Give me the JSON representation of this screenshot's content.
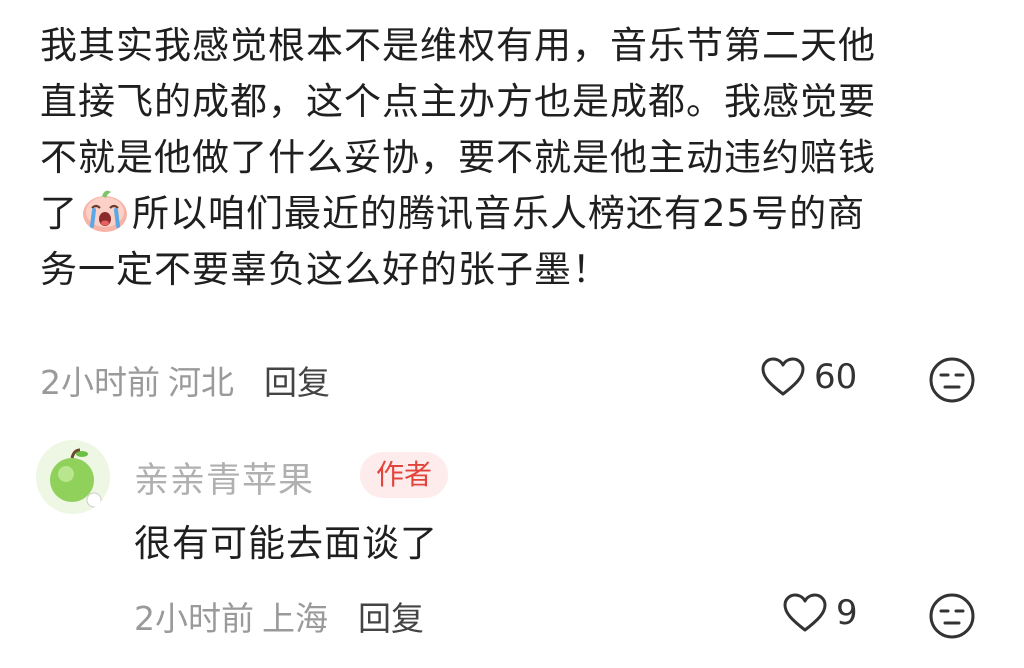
{
  "comment": {
    "lines": [
      "我其实我感觉根本不是维权有用，音乐节第二天他",
      "直接飞的成都，这个点主办方也是成都。我感觉要",
      "不就是他做了什么妥协，要不就是他主动违约赔钱"
    ],
    "line4_before_emoji": "了",
    "line4_after_emoji": "所以咱们最近的腾讯音乐人榜还有25号的商",
    "line5": "务一定不要辜负这么好的张子墨！",
    "emoji_name": "crying-emoji",
    "time": "2小时前",
    "location": "河北",
    "reply_label": "回复",
    "likes": "60"
  },
  "reply": {
    "username": "亲亲青苹果",
    "badge": "作者",
    "text": "很有可能去面谈了",
    "time": "2小时前",
    "location": "上海",
    "reply_label": "回复",
    "likes": "9"
  },
  "colors": {
    "meta_gray": "#9a9a9a",
    "badge_bg": "#fdeceb",
    "badge_text": "#e2443c",
    "username": "#b0b0b0"
  }
}
